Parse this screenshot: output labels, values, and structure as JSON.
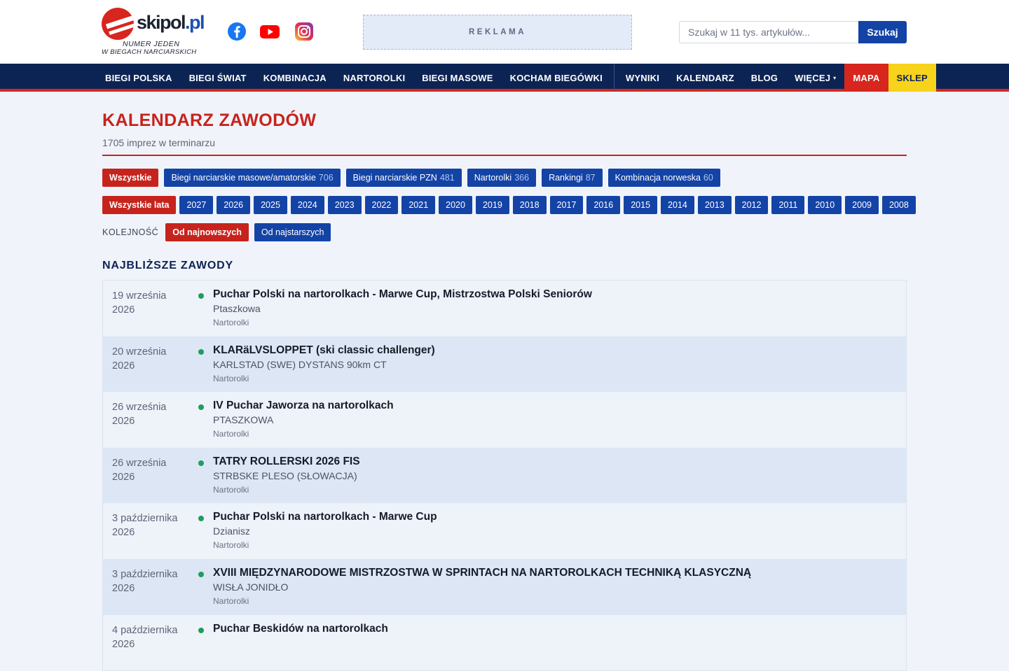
{
  "header": {
    "logo_text": "skipol",
    "logo_tld": ".pl",
    "tagline1": "NUMER JEDEN",
    "tagline2": "W BIEGACH NARCIARSKICH",
    "social": [
      {
        "icon": "facebook-icon",
        "color": "#1877f2"
      },
      {
        "icon": "youtube-icon",
        "color": "#ff0000"
      },
      {
        "icon": "instagram-icon",
        "color": "#e4405f"
      }
    ],
    "ad_label": "REKLAMA",
    "search_placeholder": "Szukaj w 11 tys. artykułów...",
    "search_button": "Szukaj"
  },
  "nav": {
    "left": [
      "BIEGI POLSKA",
      "BIEGI ŚWIAT",
      "KOMBINACJA",
      "NARTOROLKI",
      "BIEGI MASOWE",
      "KOCHAM BIEGÓWKI"
    ],
    "right": [
      "WYNIKI",
      "KALENDARZ",
      "BLOG"
    ],
    "more": "WIĘCEJ",
    "more_caret": "▾",
    "mapa": "MAPA",
    "sklep": "SKLEP"
  },
  "page": {
    "title": "KALENDARZ ZAWODÓW",
    "subtitle": "1705 imprez w terminarzu",
    "categories": [
      {
        "label": "Wszystkie",
        "count": "",
        "active": true
      },
      {
        "label": "Biegi narciarskie masowe/amatorskie",
        "count": "706",
        "active": false
      },
      {
        "label": "Biegi narciarskie PZN",
        "count": "481",
        "active": false
      },
      {
        "label": "Nartorolki",
        "count": "366",
        "active": false
      },
      {
        "label": "Rankingi",
        "count": "87",
        "active": false
      },
      {
        "label": "Kombinacja norweska",
        "count": "60",
        "active": false
      }
    ],
    "years_all": "Wszystkie lata",
    "years": [
      "2027",
      "2026",
      "2025",
      "2024",
      "2023",
      "2022",
      "2021",
      "2020",
      "2019",
      "2018",
      "2017",
      "2016",
      "2015",
      "2014",
      "2013",
      "2012",
      "2011",
      "2010",
      "2009",
      "2008"
    ],
    "order_label": "KOLEJNOŚĆ",
    "order_newest": "Od najnowszych",
    "order_oldest": "Od najstarszych",
    "section_title": "NAJBLIŻSZE ZAWODY"
  },
  "events": [
    {
      "date_day": "19 września",
      "date_year": "2026",
      "title": "Puchar Polski na nartorolkach - Marwe Cup, Mistrzostwa Polski Seniorów",
      "place": "Ptaszkowa",
      "category": "Nartorolki"
    },
    {
      "date_day": "20 września",
      "date_year": "2026",
      "title": "KLARäLVSLOPPET (ski classic challenger)",
      "place": "KARLSTAD (SWE) DYSTANS 90km CT",
      "category": "Nartorolki"
    },
    {
      "date_day": "26 września",
      "date_year": "2026",
      "title": "IV Puchar Jaworza na nartorolkach",
      "place": "PTASZKOWA",
      "category": "Nartorolki"
    },
    {
      "date_day": "26 września",
      "date_year": "2026",
      "title": "TATRY ROLLERSKI 2026 FIS",
      "place": "STRBSKE PLESO (SŁOWACJA)",
      "category": "Nartorolki"
    },
    {
      "date_day": "3 października",
      "date_year": "2026",
      "title": "Puchar Polski na nartorolkach - Marwe Cup",
      "place": "Dzianisz",
      "category": "Nartorolki"
    },
    {
      "date_day": "3 października",
      "date_year": "2026",
      "title": "XVIII MIĘDZYNARODOWE MISTRZOSTWA W SPRINTACH NA NARTOROLKACH TECHNIKĄ KLASYCZNĄ",
      "place": "WISŁA JONIDŁO",
      "category": "Nartorolki"
    },
    {
      "date_day": "4 października",
      "date_year": "2026",
      "title": "Puchar Beskidów na nartorolkach",
      "place": "",
      "category": ""
    }
  ]
}
